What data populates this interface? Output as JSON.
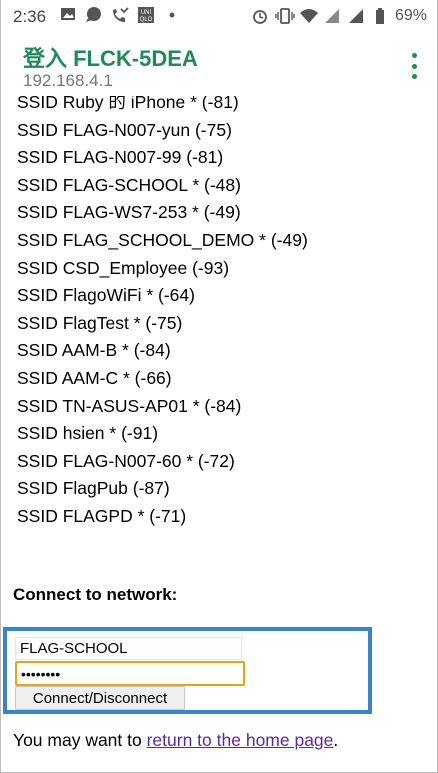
{
  "status_bar": {
    "time": "2:36",
    "battery": "69%",
    "left_icons": [
      "image-icon",
      "chat-bubble-icon",
      "missed-call-icon",
      "uniqlo-icon",
      "dot-icon"
    ],
    "right_icons": [
      "alarm-icon",
      "vibrate-icon",
      "wifi-icon",
      "signal-icon",
      "signal-icon",
      "battery-icon"
    ]
  },
  "app_bar": {
    "title": "登入 FLCK-5DEA",
    "subtitle": "192.168.4.1",
    "accent_color": "#1f8a5a"
  },
  "networks": [
    "SSID Ruby 的 iPhone * (-81)",
    "SSID FLAG-N007-yun (-75)",
    "SSID FLAG-N007-99 (-81)",
    "SSID FLAG-SCHOOL * (-48)",
    "SSID FLAG-WS7-253 * (-49)",
    "SSID FLAG_SCHOOL_DEMO * (-49)",
    "SSID CSD_Employee (-93)",
    "SSID FlagoWiFi * (-64)",
    "SSID FlagTest * (-75)",
    "SSID AAM-B * (-84)",
    "SSID AAM-C * (-66)",
    "SSID TN-ASUS-AP01 * (-84)",
    "SSID hsien * (-91)",
    "SSID FLAG-N007-60 * (-72)",
    "SSID FlagPub (-87)",
    "SSID FLAGPD * (-71)"
  ],
  "form": {
    "heading": "Connect to network:",
    "ssid_value": "FLAG-SCHOOL",
    "password_value": "••••••••",
    "button_label": "Connect/Disconnect",
    "highlight_color": "#3d84c6",
    "focus_color": "#e8a418"
  },
  "footer": {
    "prefix": "You may want to ",
    "link_text": "return to the home page",
    "suffix": "."
  }
}
